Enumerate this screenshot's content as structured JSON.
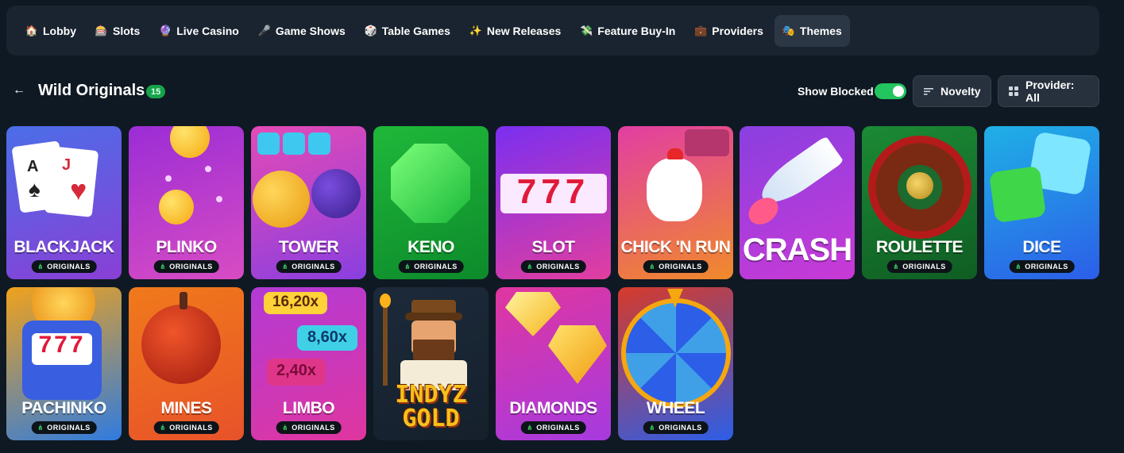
{
  "nav": {
    "items": [
      {
        "label": "Lobby",
        "icon": "lobby-icon",
        "glyph": "🏠"
      },
      {
        "label": "Slots",
        "icon": "slots-icon",
        "glyph": "🎰"
      },
      {
        "label": "Live Casino",
        "icon": "live-casino-icon",
        "glyph": "🔮"
      },
      {
        "label": "Game Shows",
        "icon": "game-shows-icon",
        "glyph": "🎤"
      },
      {
        "label": "Table Games",
        "icon": "table-games-icon",
        "glyph": "🎲"
      },
      {
        "label": "New Releases",
        "icon": "new-releases-icon",
        "glyph": "✨"
      },
      {
        "label": "Feature Buy-In",
        "icon": "feature-buy-in-icon",
        "glyph": "💸"
      },
      {
        "label": "Providers",
        "icon": "providers-icon",
        "glyph": "💼"
      },
      {
        "label": "Themes",
        "icon": "themes-icon",
        "glyph": "🎭"
      }
    ],
    "active": "Themes"
  },
  "header": {
    "back_glyph": "←",
    "title": "Wild Originals",
    "count": "15",
    "show_blocked_label": "Show Blocked",
    "show_blocked_on": true,
    "sort_label": "Novelty",
    "provider_label": "Provider: All"
  },
  "badge_label": "ORIGINALS",
  "games": [
    {
      "name": "BLACKJACK",
      "colors": [
        "#4b6ee8",
        "#8a3fd6"
      ]
    },
    {
      "name": "PLINKO",
      "colors": [
        "#9b2dd6",
        "#d84cc3"
      ]
    },
    {
      "name": "TOWER",
      "colors": [
        "#e54ab6",
        "#8a3fe0"
      ]
    },
    {
      "name": "KENO",
      "colors": [
        "#1fb83a",
        "#0d8a2b"
      ]
    },
    {
      "name": "SLOT",
      "colors": [
        "#7b2ff0",
        "#e23e9f"
      ]
    },
    {
      "name": "CHICK 'N RUN",
      "colors": [
        "#e23ea3",
        "#f08a2a"
      ]
    },
    {
      "name": "CRASH",
      "colors": [
        "#8a3fe0",
        "#c93ad6"
      ]
    },
    {
      "name": "ROULETTE",
      "colors": [
        "#1b8a35",
        "#0f5d23"
      ]
    },
    {
      "name": "DICE",
      "colors": [
        "#1fb0e6",
        "#2c5ee8"
      ]
    },
    {
      "name": "PACHINKO",
      "colors": [
        "#f0a21b",
        "#2f7be0"
      ]
    },
    {
      "name": "MINES",
      "colors": [
        "#f07a1b",
        "#e8522a"
      ]
    },
    {
      "name": "LIMBO",
      "colors": [
        "#b23ad6",
        "#e0369f"
      ]
    },
    {
      "name": "INDYZ GOLD",
      "colors": [
        "#1c2a3a",
        "#15202c"
      ]
    },
    {
      "name": "DIAMONDS",
      "colors": [
        "#e0369f",
        "#a63ae0"
      ]
    },
    {
      "name": "WHEEL",
      "colors": [
        "#d63a2a",
        "#2c5ee8"
      ]
    }
  ],
  "art_text": {
    "blackjack_cards": [
      "A",
      "♠",
      "J",
      "♥"
    ],
    "slot_digits": "777",
    "pachinko_digits": "777",
    "limbo_multipliers": [
      "16,20x",
      "8,60x",
      "2,40x"
    ],
    "indyz_lines": [
      "INDYZ",
      "GOLD"
    ]
  }
}
